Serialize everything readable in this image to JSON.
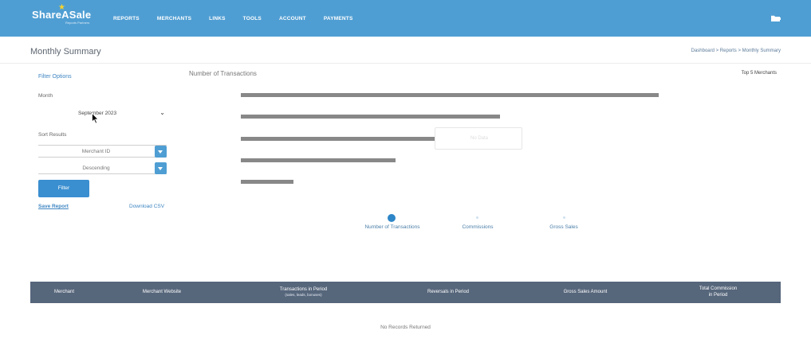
{
  "header": {
    "brand": "ShareASale",
    "brand_tagline": "Reports Partners",
    "nav": [
      "REPORTS",
      "MERCHANTS",
      "LINKS",
      "TOOLS",
      "ACCOUNT",
      "PAYMENTS"
    ],
    "colors": {
      "bar": "#4f9ed3",
      "accent": "#3a8fd0"
    }
  },
  "page": {
    "title": "Monthly Summary",
    "breadcrumb": "Dashboard > Reports > Monthly Summary"
  },
  "sidebar": {
    "filter_options": "Filter Options",
    "month_label": "Month",
    "month_value": "September 2023",
    "sort_label": "Sort Results",
    "sort_by_value": "Merchant ID",
    "sort_order_value": "Descending",
    "filter_button": "Filter",
    "save_report": "Save Report",
    "download_csv": "Download CSV"
  },
  "chart": {
    "title": "Number of Transactions",
    "right_label": "Top 5 Merchants",
    "tooltip_text": "No Data",
    "tabs": [
      "Number of Transactions",
      "Commissions",
      "Gross Sales"
    ],
    "active_tab": 0
  },
  "chart_data": {
    "type": "bar",
    "orientation": "horizontal",
    "categories": [
      "",
      "",
      "",
      "",
      ""
    ],
    "values": [
      100,
      62,
      47,
      37,
      12.5
    ],
    "bar_color": "#888888"
  },
  "table": {
    "columns": [
      {
        "label": "Merchant",
        "sub": ""
      },
      {
        "label": "Merchant Website",
        "sub": ""
      },
      {
        "label": "Transactions in Period",
        "sub": "(sales, leads, bonuses)"
      },
      {
        "label": "Reversals in Period",
        "sub": ""
      },
      {
        "label": "Gross Sales Amount",
        "sub": ""
      },
      {
        "label": "Total Commission",
        "sub": "in Period"
      }
    ],
    "empty_message": "No Records Returned"
  }
}
